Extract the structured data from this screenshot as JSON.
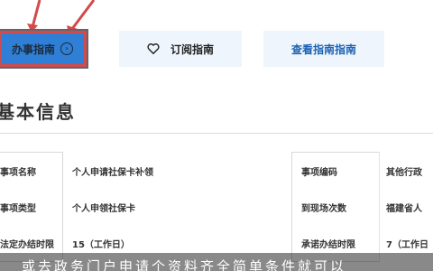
{
  "tabs": {
    "guide_label": "办事指南",
    "subscribe_label": "订阅指南",
    "query_label": "查看指南指南"
  },
  "section": {
    "title": "基本信息"
  },
  "info_table": {
    "left_rows": [
      {
        "label": "事项名称",
        "value": "个人申请社保卡补领"
      },
      {
        "label": "事项类型",
        "value": "个人申领社保卡"
      },
      {
        "label": "法定办结时限",
        "value": "15（工作日）"
      }
    ],
    "right_rows": [
      {
        "label": "事项编码",
        "value": "其他行政"
      },
      {
        "label": "到现场次数",
        "value": "福建省人"
      },
      {
        "label": "承诺办结时限",
        "value": "7（工作日"
      }
    ]
  },
  "caption": {
    "text": "或去政务门户申请个资料齐全简单条件就可以"
  },
  "colors": {
    "accent_tab": "#2f7fd6",
    "highlight_border": "#d24a4a",
    "light_tab": "#eef5fc",
    "link_text": "#1d62b3"
  }
}
